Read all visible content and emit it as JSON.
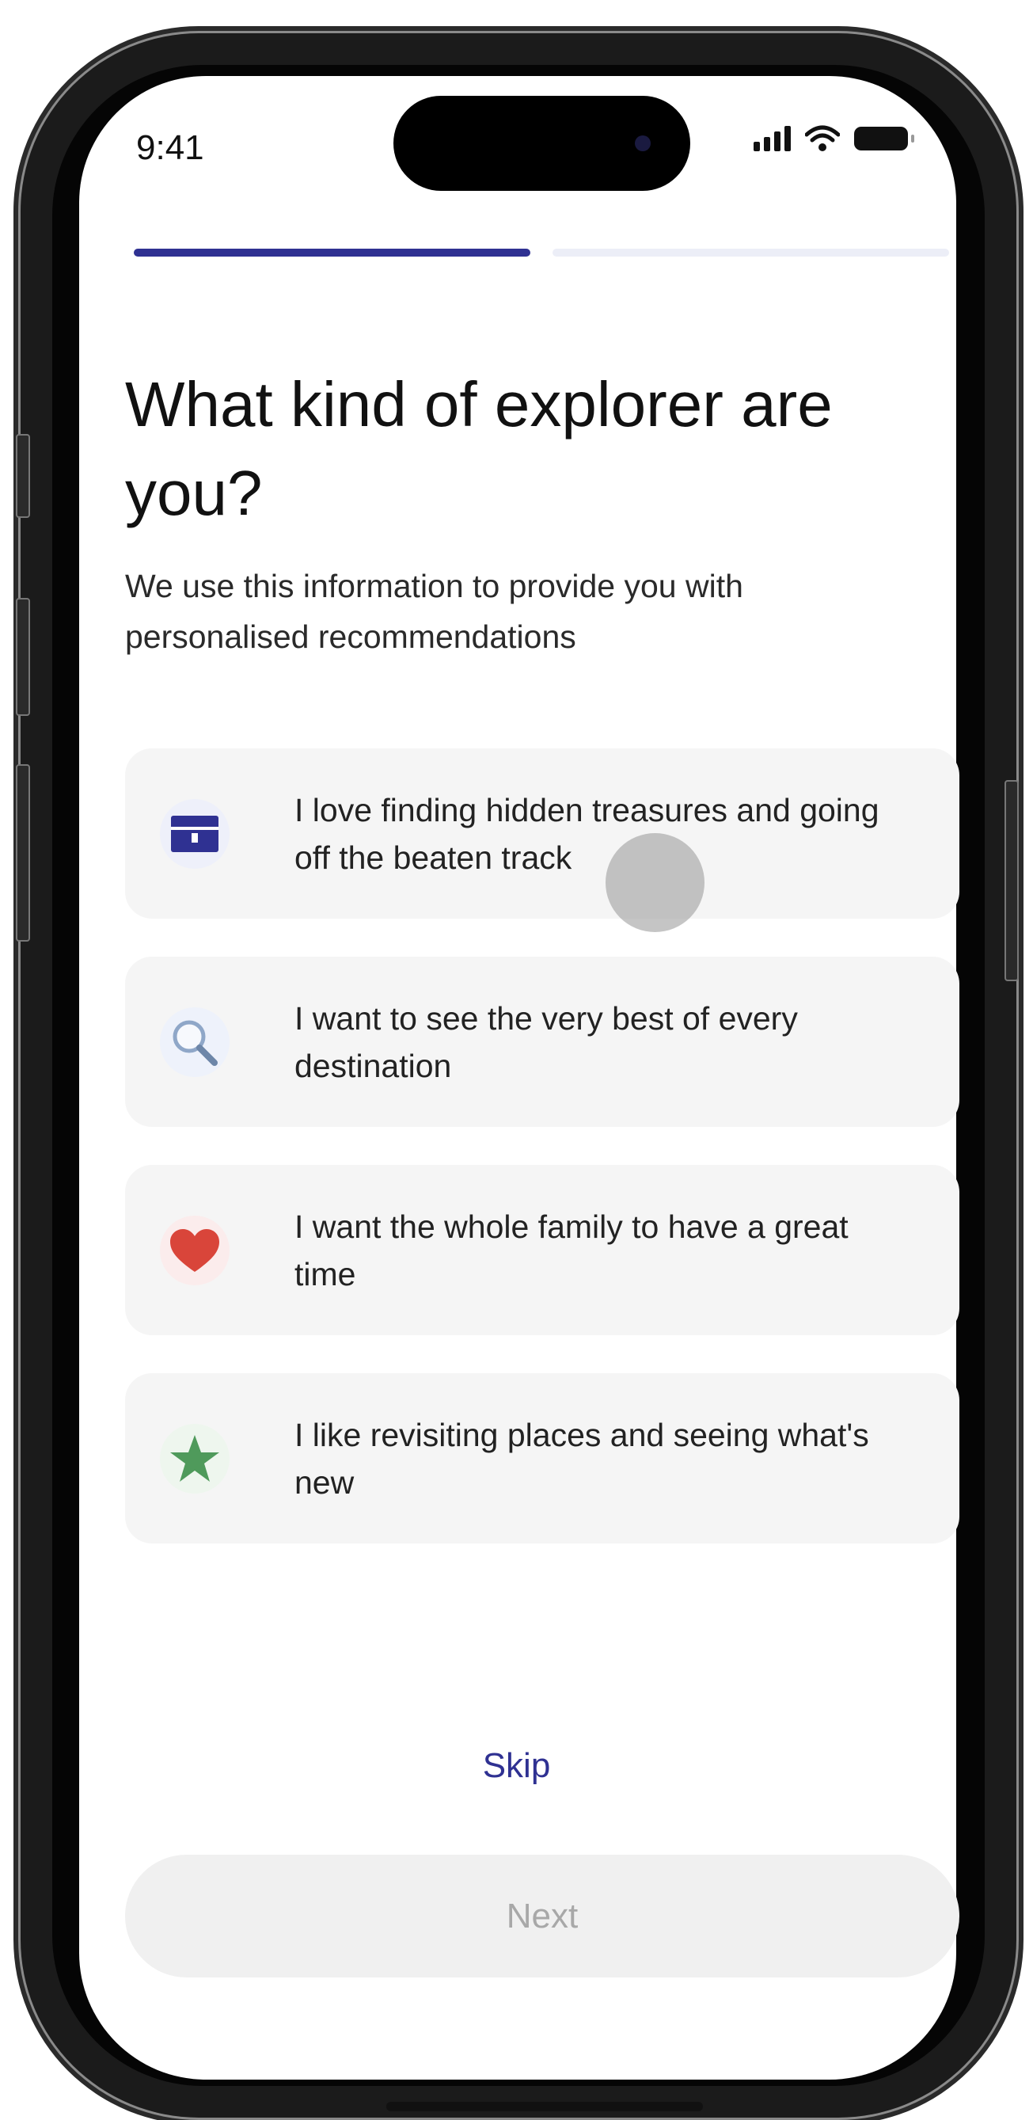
{
  "status_bar": {
    "time": "9:41",
    "icons": [
      "signal-icon",
      "wifi-icon",
      "battery-icon"
    ]
  },
  "progress": {
    "total_steps": 2,
    "current_step": 1
  },
  "page": {
    "title": "What kind of explorer are you?",
    "subtitle": "We use this information to provide you with personalised recommendations"
  },
  "options": [
    {
      "icon": "treasure-chest-icon",
      "label": "I love finding hidden treasures and going off the beaten track",
      "color": "#2f3192"
    },
    {
      "icon": "magnifier-icon",
      "label": "I want to see the very best of every destination",
      "color": "#8fa7c8"
    },
    {
      "icon": "heart-icon",
      "label": "I want the whole family to have a great time",
      "color": "#d9453a"
    },
    {
      "icon": "star-icon",
      "label": "I like revisiting places and seeing what's new",
      "color": "#4f9a5b"
    }
  ],
  "actions": {
    "skip_label": "Skip",
    "next_label": "Next"
  },
  "colors": {
    "accent": "#2f3192",
    "card_bg": "#f5f5f5",
    "disabled_text": "#a8a8a8"
  }
}
